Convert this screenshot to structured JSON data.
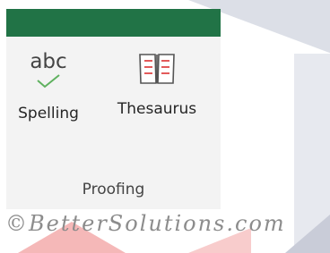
{
  "colors": {
    "ribbon_green": "#217346",
    "panel_bg": "#f3f3f3",
    "check_green": "#5fb15f",
    "book_red": "#e04848"
  },
  "ribbon": {
    "commands": [
      {
        "label": "Spelling",
        "icon": "spelling-abc-check-icon",
        "icon_text": "abc"
      },
      {
        "label": "Thesaurus",
        "icon": "thesaurus-book-icon"
      }
    ],
    "group_label": "Proofing"
  },
  "watermark": "©BetterSolutions.com"
}
